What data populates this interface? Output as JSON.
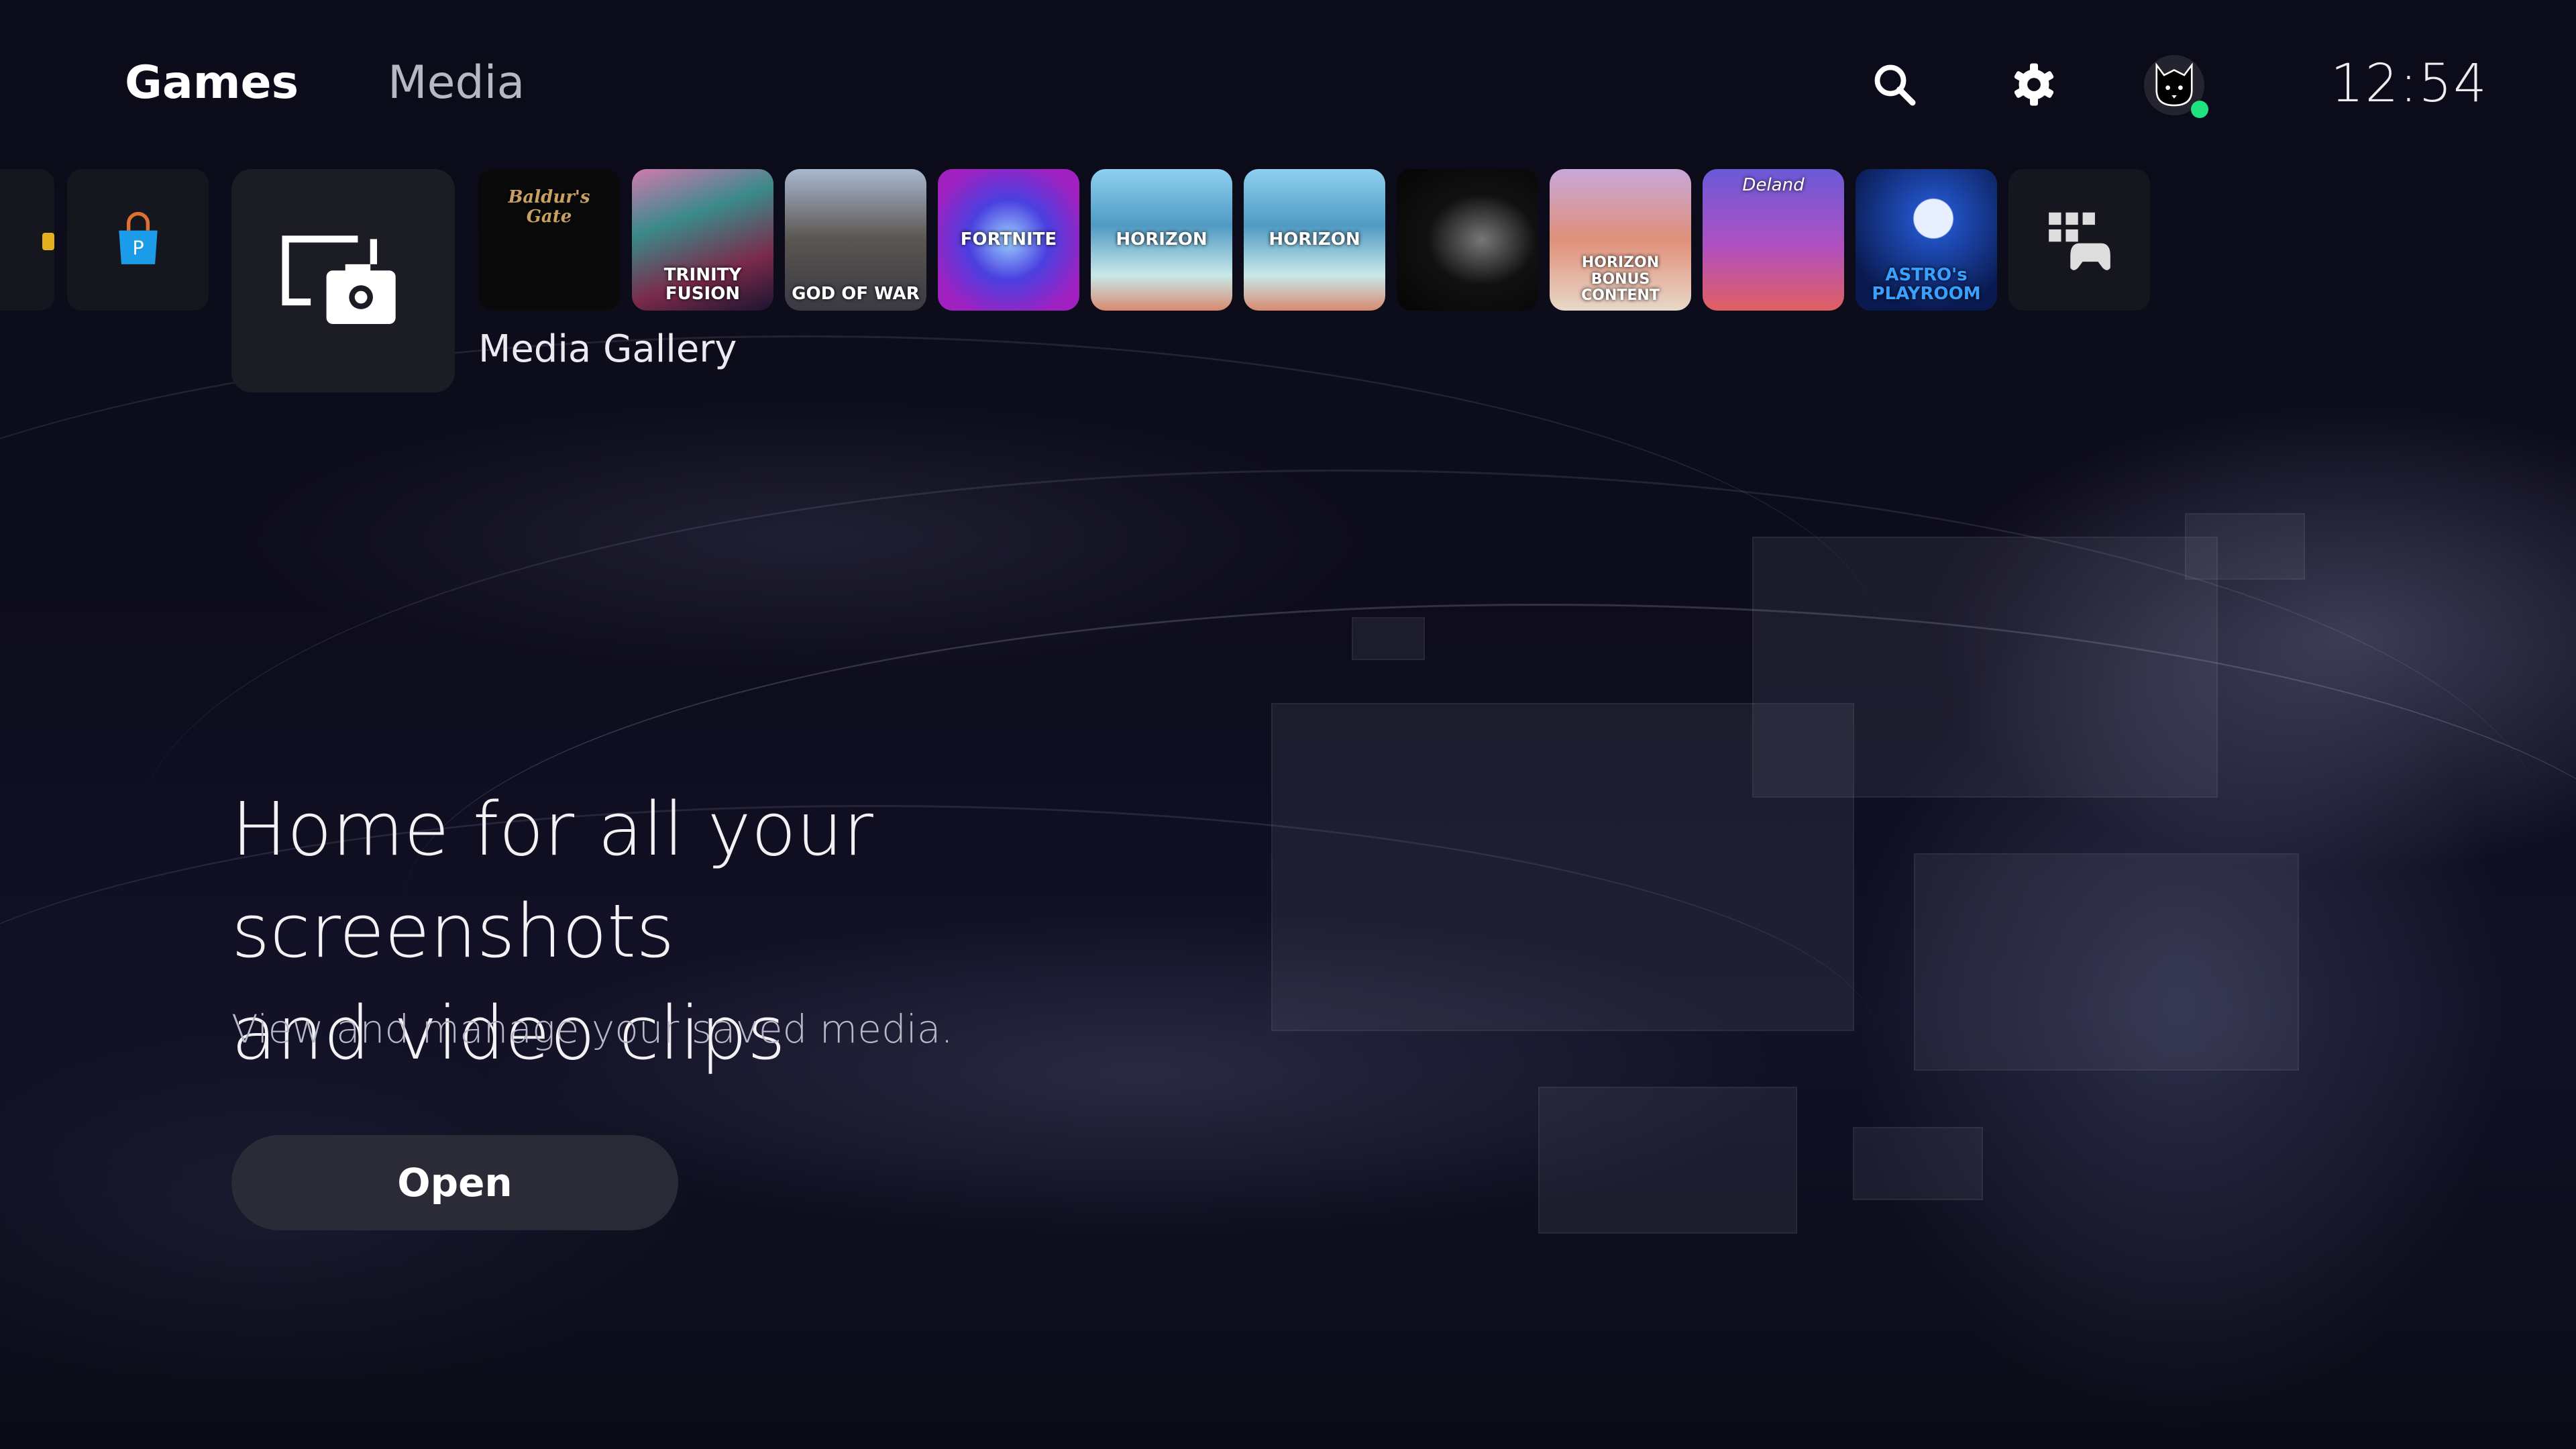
{
  "header": {
    "tabs": [
      {
        "label": "Games",
        "active": true
      },
      {
        "label": "Media",
        "active": false
      }
    ],
    "icons": [
      "search-icon",
      "gear-icon",
      "avatar-icon"
    ],
    "clock": "12:54",
    "online_color": "#1ee27f"
  },
  "tiles": {
    "items": [
      {
        "title": "Baldur's Gate",
        "color": "#0a0a0a"
      },
      {
        "title": "TRINITY FUSION",
        "color": "#7a3a6a"
      },
      {
        "title": "GOD OF WAR",
        "color": "#4a5568"
      },
      {
        "title": "FORTNITE",
        "color": "#6a2ad8"
      },
      {
        "title": "HORIZON",
        "color": "#4f9ac4"
      },
      {
        "title": "HORIZON",
        "color": "#4f9ac4"
      },
      {
        "title": "",
        "color": "#0d0d0d"
      },
      {
        "title": "HORIZON BONUS CONTENT",
        "color": "#d49a80"
      },
      {
        "title": "Deland",
        "color": "#8a4ab8"
      },
      {
        "title": "ASTRO's PLAYROOM",
        "color": "#0c2f7a"
      }
    ],
    "selected_label": "Media Gallery"
  },
  "hero": {
    "title_line1": "Home for all your screenshots",
    "title_line2": "and video clips",
    "subtitle": "View and manage your saved media.",
    "open_label": "Open"
  }
}
